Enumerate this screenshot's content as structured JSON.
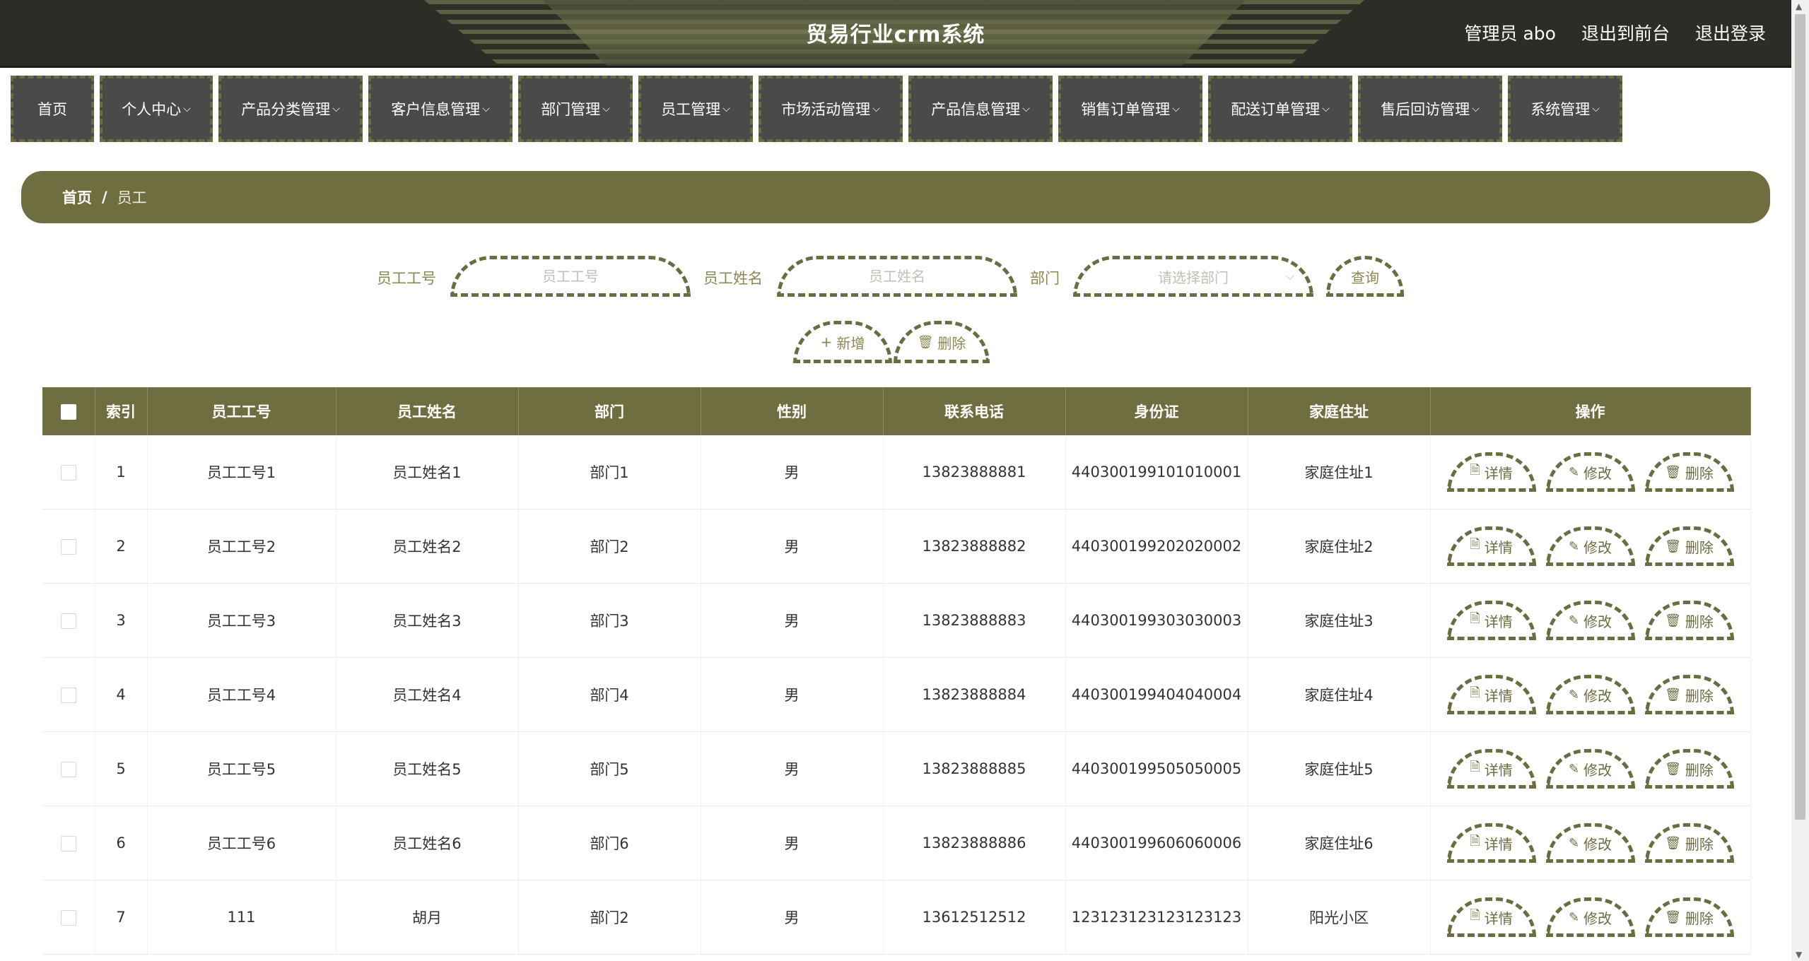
{
  "header": {
    "title": "贸易行业crm系统",
    "admin": "管理员 abo",
    "to_front": "退出到前台",
    "logout": "退出登录"
  },
  "nav": [
    {
      "label": "首页",
      "dropdown": false
    },
    {
      "label": "个人中心",
      "dropdown": true
    },
    {
      "label": "产品分类管理",
      "dropdown": true
    },
    {
      "label": "客户信息管理",
      "dropdown": true
    },
    {
      "label": "部门管理",
      "dropdown": true
    },
    {
      "label": "员工管理",
      "dropdown": true
    },
    {
      "label": "市场活动管理",
      "dropdown": true
    },
    {
      "label": "产品信息管理",
      "dropdown": true
    },
    {
      "label": "销售订单管理",
      "dropdown": true
    },
    {
      "label": "配送订单管理",
      "dropdown": true
    },
    {
      "label": "售后回访管理",
      "dropdown": true
    },
    {
      "label": "系统管理",
      "dropdown": true
    }
  ],
  "breadcrumb": {
    "home": "首页",
    "separator": "/",
    "current": "员工"
  },
  "search": {
    "label_no": "员工工号",
    "placeholder_no": "员工工号",
    "label_name": "员工姓名",
    "placeholder_name": "员工姓名",
    "label_dept": "部门",
    "placeholder_dept": "请选择部门",
    "query": "查询",
    "add": "新增",
    "delete": "删除"
  },
  "table": {
    "headers": [
      "索引",
      "员工工号",
      "员工姓名",
      "部门",
      "性别",
      "联系电话",
      "身份证",
      "家庭住址",
      "操作"
    ],
    "ops": {
      "detail": "详情",
      "edit": "修改",
      "delete": "删除"
    },
    "rows": [
      [
        "1",
        "员工工号1",
        "员工姓名1",
        "部门1",
        "男",
        "13823888881",
        "440300199101010001",
        "家庭住址1"
      ],
      [
        "2",
        "员工工号2",
        "员工姓名2",
        "部门2",
        "男",
        "13823888882",
        "440300199202020002",
        "家庭住址2"
      ],
      [
        "3",
        "员工工号3",
        "员工姓名3",
        "部门3",
        "男",
        "13823888883",
        "440300199303030003",
        "家庭住址3"
      ],
      [
        "4",
        "员工工号4",
        "员工姓名4",
        "部门4",
        "男",
        "13823888884",
        "440300199404040004",
        "家庭住址4"
      ],
      [
        "5",
        "员工工号5",
        "员工姓名5",
        "部门5",
        "男",
        "13823888885",
        "440300199505050005",
        "家庭住址5"
      ],
      [
        "6",
        "员工工号6",
        "员工姓名6",
        "部门6",
        "男",
        "13823888886",
        "440300199606060006",
        "家庭住址6"
      ],
      [
        "7",
        "111",
        "胡月",
        "部门2",
        "男",
        "13612512512",
        "123123123123123123",
        "阳光小区"
      ]
    ]
  },
  "colors": {
    "accent": "#6f6e40",
    "dashed": "#6d6b40",
    "nav_bg": "#4a4a48",
    "header_bg": "#2b2d27"
  }
}
